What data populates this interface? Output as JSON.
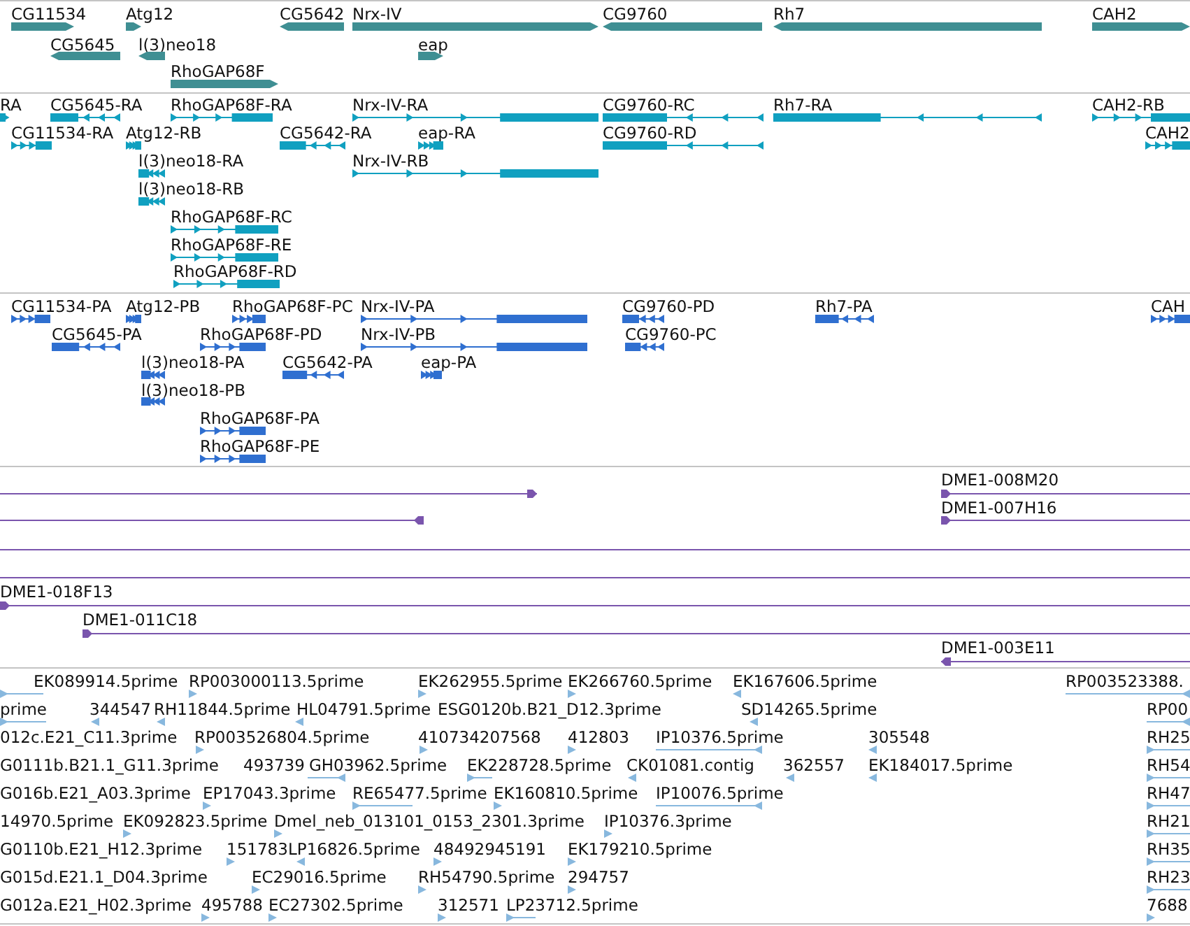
{
  "tracks": [
    {
      "kind": "gene",
      "color": "#3f8f93",
      "features": [
        {
          "label": "CG11534",
          "reverse": false
        },
        {
          "label": "Atg12",
          "reverse": false
        },
        {
          "label": "CG5642",
          "reverse": true
        },
        {
          "label": "Nrx-IV",
          "reverse": false
        },
        {
          "label": "CG9760",
          "reverse": true
        },
        {
          "label": "Rh7",
          "reverse": true
        },
        {
          "label": "CAH2",
          "reverse": false
        },
        {
          "label": "CG5645",
          "reverse": true
        },
        {
          "label": "l(3)neo18",
          "reverse": true
        },
        {
          "label": "eap",
          "reverse": false
        },
        {
          "label": "RhoGAP68F",
          "reverse": false
        }
      ]
    },
    {
      "kind": "transcript",
      "color": "#10a0c0",
      "features": [
        {
          "label": "RA",
          "reverse": false
        },
        {
          "label": "CG5645-RA",
          "reverse": true
        },
        {
          "label": "RhoGAP68F-RA",
          "reverse": false
        },
        {
          "label": "Nrx-IV-RA",
          "reverse": false
        },
        {
          "label": "CG9760-RC",
          "reverse": true
        },
        {
          "label": "Rh7-RA",
          "reverse": true
        },
        {
          "label": "CAH2-RB",
          "reverse": false
        },
        {
          "label": "CG11534-RA",
          "reverse": false
        },
        {
          "label": "Atg12-RB",
          "reverse": false
        },
        {
          "label": "CG5642-RA",
          "reverse": true
        },
        {
          "label": "eap-RA",
          "reverse": false
        },
        {
          "label": "CG9760-RD",
          "reverse": true
        },
        {
          "label": "CAH2",
          "reverse": false
        },
        {
          "label": "l(3)neo18-RA",
          "reverse": true
        },
        {
          "label": "Nrx-IV-RB",
          "reverse": false
        },
        {
          "label": "l(3)neo18-RB",
          "reverse": true
        },
        {
          "label": "RhoGAP68F-RC",
          "reverse": false
        },
        {
          "label": "RhoGAP68F-RE",
          "reverse": false
        },
        {
          "label": "RhoGAP68F-RD",
          "reverse": false
        }
      ]
    },
    {
      "kind": "transcript",
      "color": "#2f6fd0",
      "features": [
        {
          "label": "CG11534-PA",
          "reverse": false
        },
        {
          "label": "Atg12-PB",
          "reverse": false
        },
        {
          "label": "RhoGAP68F-PC",
          "reverse": false
        },
        {
          "label": "Nrx-IV-PA",
          "reverse": false
        },
        {
          "label": "CG9760-PD",
          "reverse": true
        },
        {
          "label": "Rh7-PA",
          "reverse": true
        },
        {
          "label": "CAH",
          "reverse": false
        },
        {
          "label": "CG5645-PA",
          "reverse": true
        },
        {
          "label": "RhoGAP68F-PD",
          "reverse": false
        },
        {
          "label": "Nrx-IV-PB",
          "reverse": false
        },
        {
          "label": "CG9760-PC",
          "reverse": true
        },
        {
          "label": "l(3)neo18-PA",
          "reverse": true
        },
        {
          "label": "CG5642-PA",
          "reverse": true
        },
        {
          "label": "eap-PA",
          "reverse": false
        },
        {
          "label": "l(3)neo18-PB",
          "reverse": true
        },
        {
          "label": "RhoGAP68F-PA",
          "reverse": false
        },
        {
          "label": "RhoGAP68F-PE",
          "reverse": false
        }
      ]
    },
    {
      "kind": "clone",
      "color": "#7a55ad",
      "features": [
        {
          "kind": "clone",
          "reverse": false
        },
        {
          "kind": "clone",
          "label": "DME1-008M20",
          "reverse": false
        },
        {
          "kind": "clone",
          "reverse": true
        },
        {
          "kind": "clone",
          "label": "DME1-007H16",
          "reverse": false
        },
        {
          "kind": "line"
        },
        {
          "kind": "line"
        },
        {
          "kind": "clone",
          "label": "DME1-018F13",
          "reverse": false
        },
        {
          "kind": "clone",
          "label": "DME1-011C18",
          "reverse": false
        },
        {
          "kind": "clone",
          "label": "DME1-003E11",
          "reverse": true
        }
      ]
    },
    {
      "kind": "est",
      "color": "#88b8de",
      "features": [
        {
          "label": "EK089914.5prime",
          "reverse": false
        },
        {
          "label": "RP003000113.5prime",
          "reverse": false
        },
        {
          "label": "EK262955.5prime",
          "reverse": false
        },
        {
          "label": "EK266760.5prime",
          "reverse": false
        },
        {
          "label": "EK167606.5prime",
          "reverse": true
        },
        {
          "label": "RP003523388.",
          "reverse": true
        },
        {
          "label": "prime",
          "reverse": false
        },
        {
          "label": "344547",
          "reverse": true
        },
        {
          "label": "RH11844.5prime",
          "reverse": true
        },
        {
          "label": "HL04791.5prime",
          "reverse": true
        },
        {
          "label": "ESG0120b.B21_D12.3prime"
        },
        {
          "label": "SD14265.5prime",
          "reverse": true
        },
        {
          "label": "RP00",
          "reverse": true
        },
        {
          "label": "012c.E21_C11.3prime"
        },
        {
          "label": "RP003526804.5prime",
          "reverse": false
        },
        {
          "label": "410734207568",
          "reverse": false
        },
        {
          "label": "412803",
          "reverse": false
        },
        {
          "label": "IP10376.5prime",
          "reverse": true
        },
        {
          "label": "305548",
          "reverse": true
        },
        {
          "label": "RH25",
          "reverse": false
        },
        {
          "label": "G0111b.B21.1_G11.3prime"
        },
        {
          "label": "493739"
        },
        {
          "label": "GH03962.5prime",
          "reverse": true
        },
        {
          "label": "EK228728.5prime",
          "reverse": false
        },
        {
          "label": "CK01081.contig",
          "reverse": true
        },
        {
          "label": "362557",
          "reverse": true
        },
        {
          "label": "EK184017.5prime",
          "reverse": true
        },
        {
          "label": "RH54",
          "reverse": false
        },
        {
          "label": "G016b.E21_A03.3prime"
        },
        {
          "label": "EP17043.3prime",
          "reverse": false
        },
        {
          "label": "RE65477.5prime",
          "reverse": false
        },
        {
          "label": "EK160810.5prime",
          "reverse": false
        },
        {
          "label": "IP10076.5prime",
          "reverse": true
        },
        {
          "label": "RH47",
          "reverse": false
        },
        {
          "label": "14970.5prime"
        },
        {
          "label": "EK092823.5prime",
          "reverse": false
        },
        {
          "label": "Dmel_neb_013101_0153_2301.3prime",
          "reverse": false
        },
        {
          "label": "IP10376.3prime",
          "reverse": false
        },
        {
          "label": "RH21",
          "reverse": false
        },
        {
          "label": "G0110b.E21_H12.3prime"
        },
        {
          "label": "151783",
          "reverse": false
        },
        {
          "label": "LP16826.5prime",
          "reverse": true
        },
        {
          "label": "48492945191",
          "reverse": false
        },
        {
          "label": "EK179210.5prime",
          "reverse": false
        },
        {
          "label": "RH35",
          "reverse": false
        },
        {
          "label": "G015d.E21.1_D04.3prime"
        },
        {
          "label": "EC29016.5prime",
          "reverse": false
        },
        {
          "label": "RH54790.5prime",
          "reverse": false
        },
        {
          "label": "294757",
          "reverse": false
        },
        {
          "label": "RH23",
          "reverse": false
        },
        {
          "label": "G012a.E21_H02.3prime"
        },
        {
          "label": "495788",
          "reverse": false
        },
        {
          "label": "EC27302.5prime",
          "reverse": false
        },
        {
          "label": "312571",
          "reverse": false
        },
        {
          "label": "LP23712.5prime",
          "reverse": false
        },
        {
          "label": "7688",
          "reverse": false
        }
      ]
    }
  ]
}
